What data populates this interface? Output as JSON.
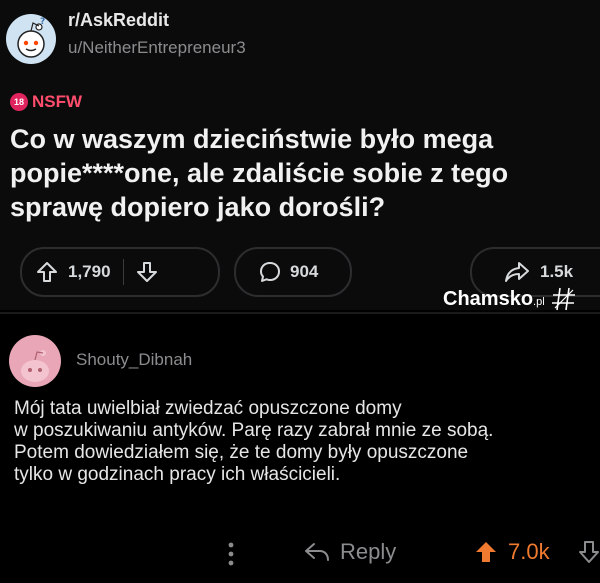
{
  "post": {
    "subreddit": "r/AskReddit",
    "author": "u/NeitherEntrepreneur3",
    "nsfw_badge": "18",
    "nsfw_label": "NSFW",
    "title_lines": [
      "Co w waszym dzieciństwie było mega",
      "popie****one, ale zdaliście sobie z tego",
      "sprawę dopiero jako dorośli?"
    ],
    "upvotes": "1,790",
    "comments": "904",
    "shares": "1.5k"
  },
  "watermark": {
    "brand": "Chamsko",
    "suffix": ".pl"
  },
  "comment": {
    "author": "Shouty_Dibnah",
    "lines": [
      "Mój tata uwielbiał zwiedzać opuszczone domy",
      "w poszukiwaniu antyków. Parę razy zabrał mnie ze sobą.",
      "Potem dowiedziałem się, że te domy były opuszczone",
      "tylko w godzinach pracy ich właścicieli."
    ],
    "reply_label": "Reply",
    "score": "7.0k"
  },
  "colors": {
    "accent_upvote": "#f07a2f",
    "nsfw": "#ff4d6d",
    "background": "#000000"
  }
}
